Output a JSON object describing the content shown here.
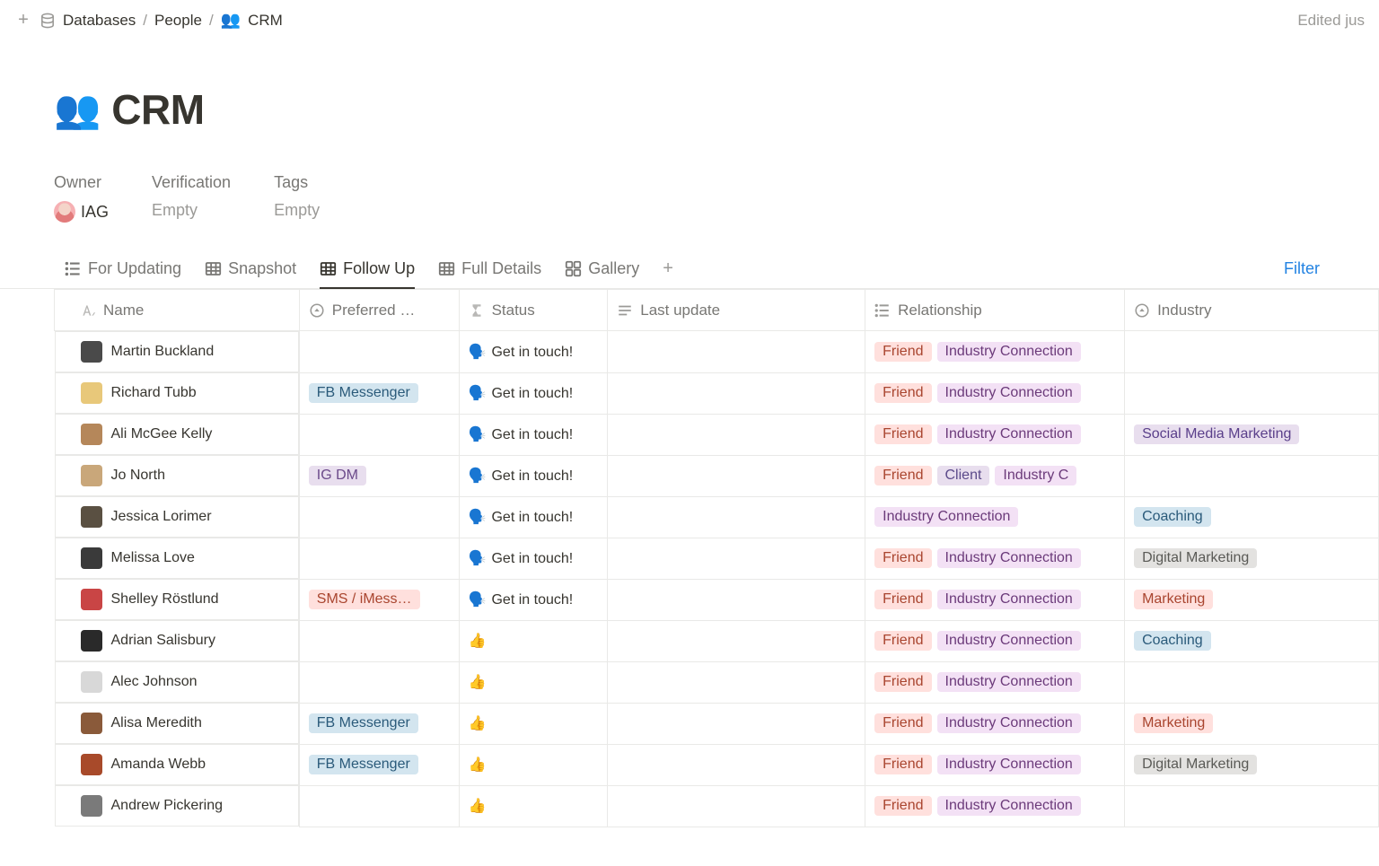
{
  "breadcrumb": {
    "root": "Databases",
    "parent": "People",
    "current": "CRM"
  },
  "edited_text": "Edited jus",
  "page": {
    "title": "CRM"
  },
  "meta": {
    "owner_label": "Owner",
    "owner_value": "IAG",
    "verification_label": "Verification",
    "verification_value": "Empty",
    "tags_label": "Tags",
    "tags_value": "Empty"
  },
  "tabs": {
    "for_updating": "For Updating",
    "snapshot": "Snapshot",
    "follow_up": "Follow Up",
    "full_details": "Full Details",
    "gallery": "Gallery",
    "filter": "Filter"
  },
  "columns": {
    "name": "Name",
    "preferred": "Preferred …",
    "status": "Status",
    "last_update": "Last update",
    "relationship": "Relationship",
    "industry": "Industry"
  },
  "status_text": {
    "get_in_touch": "Get in touch!",
    "thumbs": "👍"
  },
  "tag_labels": {
    "friend": "Friend",
    "industry_connection": "Industry Connection",
    "industry_c": "Industry C",
    "client": "Client",
    "fbm": "FB Messenger",
    "igdm": "IG DM",
    "sms": "SMS / iMess…",
    "social_media": "Social Media Marketing",
    "coaching": "Coaching",
    "digital_marketing": "Digital Marketing",
    "marketing": "Marketing"
  },
  "rows": [
    {
      "name": "Martin Buckland",
      "avatar": "#4a4a4a",
      "preferred": null,
      "status": "get_in_touch",
      "relationship": [
        "friend",
        "industry_connection"
      ],
      "industry": []
    },
    {
      "name": "Richard Tubb",
      "avatar": "#e8c87a",
      "preferred": "fbm",
      "status": "get_in_touch",
      "relationship": [
        "friend",
        "industry_connection"
      ],
      "industry": []
    },
    {
      "name": "Ali McGee Kelly",
      "avatar": "#b5875a",
      "preferred": null,
      "status": "get_in_touch",
      "relationship": [
        "friend",
        "industry_connection"
      ],
      "industry": [
        "social_media"
      ]
    },
    {
      "name": "Jo North",
      "avatar": "#c9a77a",
      "preferred": "igdm",
      "status": "get_in_touch",
      "relationship": [
        "friend",
        "client",
        "industry_c"
      ],
      "industry": []
    },
    {
      "name": "Jessica Lorimer",
      "avatar": "#5a5042",
      "preferred": null,
      "status": "get_in_touch",
      "relationship": [
        "industry_connection_full"
      ],
      "industry": [
        "coaching"
      ]
    },
    {
      "name": "Melissa Love",
      "avatar": "#3a3a3a",
      "preferred": null,
      "status": "get_in_touch",
      "relationship": [
        "friend",
        "industry_connection"
      ],
      "industry": [
        "digital_marketing"
      ]
    },
    {
      "name": "Shelley Röstlund",
      "avatar": "#c94545",
      "preferred": "sms",
      "status": "get_in_touch",
      "relationship": [
        "friend",
        "industry_connection"
      ],
      "industry": [
        "marketing"
      ]
    },
    {
      "name": "Adrian Salisbury",
      "avatar": "#2a2a2a",
      "preferred": null,
      "status": "thumbs",
      "relationship": [
        "friend",
        "industry_connection"
      ],
      "industry": [
        "coaching"
      ]
    },
    {
      "name": "Alec Johnson",
      "avatar": "#d8d8d8",
      "preferred": null,
      "status": "thumbs",
      "relationship": [
        "friend",
        "industry_connection"
      ],
      "industry": []
    },
    {
      "name": "Alisa Meredith",
      "avatar": "#8a5a3a",
      "preferred": "fbm",
      "status": "thumbs",
      "relationship": [
        "friend",
        "industry_connection"
      ],
      "industry": [
        "marketing"
      ]
    },
    {
      "name": "Amanda Webb",
      "avatar": "#a84a2a",
      "preferred": "fbm",
      "status": "thumbs",
      "relationship": [
        "friend",
        "industry_connection"
      ],
      "industry": [
        "digital_marketing"
      ]
    },
    {
      "name": "Andrew Pickering",
      "avatar": "#7a7a7a",
      "preferred": null,
      "status": "thumbs",
      "relationship": [
        "friend",
        "industry_connection"
      ],
      "industry": []
    }
  ]
}
